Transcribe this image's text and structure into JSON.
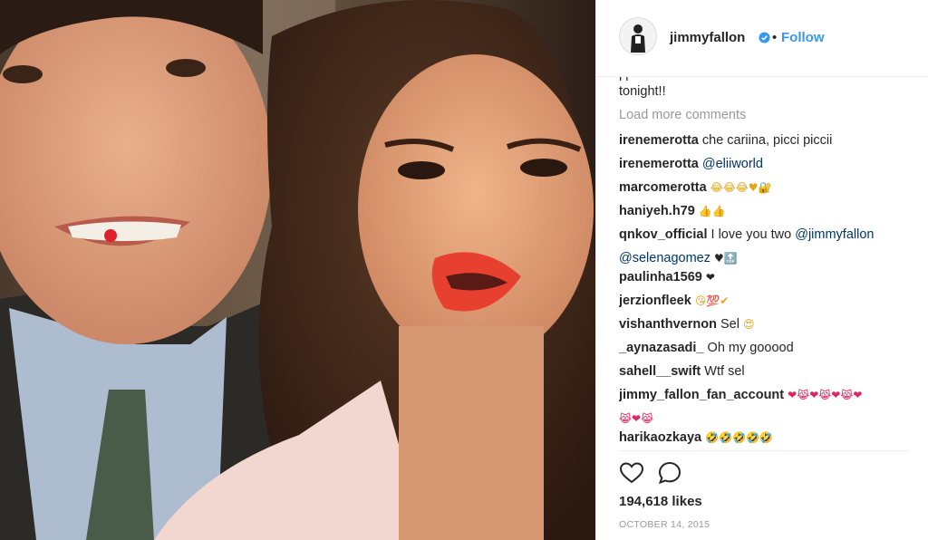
{
  "post": {
    "photo_label": "photo-jimmy-and-selena"
  },
  "header": {
    "username": "jimmyfallon",
    "separator": "•",
    "follow_label": "Follow"
  },
  "caption": {
    "partial_line": "j       j      ",
    "last_line": "tonight!!"
  },
  "load_more_label": "Load more comments",
  "comments": [
    {
      "user": "irenemerotta",
      "text": "che cariina, picci piccii",
      "mention": "",
      "emoji": ""
    },
    {
      "user": "irenemerotta",
      "text": "",
      "mention": "@eliiworld",
      "emoji": ""
    },
    {
      "user": "marcomerotta",
      "text": "",
      "mention": "",
      "emoji": "😂😂😂♥🔐"
    },
    {
      "user": "haniyeh.h79",
      "text": "",
      "mention": "",
      "emoji": "👍👍"
    },
    {
      "user": "qnkov_official",
      "text": "I love you two",
      "mention": "@jimmyfallon",
      "mention2": "@selenagomez",
      "emoji": "♥🔝"
    },
    {
      "user": "paulinha1569",
      "text": "",
      "mention": "",
      "emoji": "❤"
    },
    {
      "user": "jerzionfleek",
      "text": "",
      "mention": "",
      "emoji": "😘💯✔"
    },
    {
      "user": "vishanthvernon",
      "text": "Sel",
      "mention": "",
      "emoji": "😍"
    },
    {
      "user": "_aynazasadi_",
      "text": "Oh my gooood",
      "mention": "",
      "emoji": ""
    },
    {
      "user": "sahell__swift",
      "text": "Wtf sel",
      "mention": "",
      "emoji": ""
    },
    {
      "user": "jimmy_fallon_fan_account",
      "text": "",
      "mention": "",
      "emoji": "❤😹❤😹❤😹❤",
      "emoji_line2": "😹❤😹"
    },
    {
      "user": "harikaozkaya",
      "text": "",
      "mention": "",
      "emoji": "🤣🤣🤣🤣🤣"
    }
  ],
  "likes_label": "194,618 likes",
  "date_label": "OCTOBER 14, 2015",
  "icons": {
    "like": "heart-icon",
    "comment": "comment-icon",
    "verified": "verified-badge-icon"
  },
  "colors": {
    "link_blue": "#3897f0",
    "mention_blue": "#003569",
    "muted_gray": "#999999",
    "divider": "#efefef"
  }
}
